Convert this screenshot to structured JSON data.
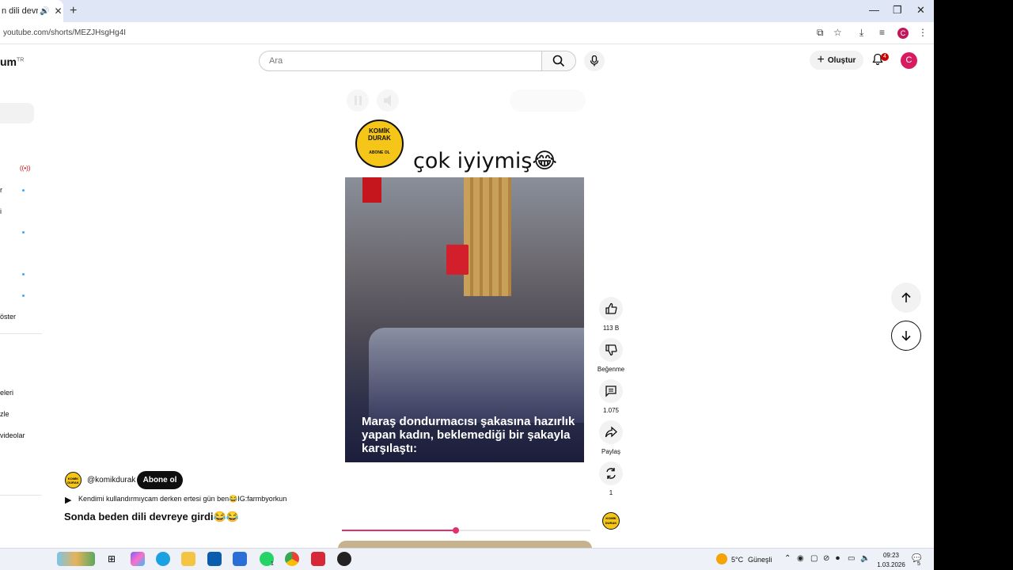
{
  "browser": {
    "tab_title": "n dili devreye",
    "tab_audio_icon": "speaker-icon",
    "url": "youtube.com/shorts/MEZJHsgHg4I",
    "profile_initial": "C"
  },
  "header": {
    "logo_text": "um",
    "logo_region": "TR",
    "search_placeholder": "Ara",
    "create_label": "Oluştur",
    "notification_count": "4",
    "avatar_initial": "C"
  },
  "sidebar": {
    "fragments": [
      "r",
      "i",
      "öster",
      "eleri",
      "zle",
      "videolar"
    ]
  },
  "video": {
    "badge_line1": "KOMİK",
    "badge_line2": "DURAK",
    "badge_sub": "ABONE OL",
    "caption": "çok iyiymiş😂",
    "overlay_text": "Maraş dondurmacısı şakasına hazırlık yapan kadın, beklemediği bir şakayla karşılaştı:",
    "progress": 0.46
  },
  "actions": {
    "like_count": "113 B",
    "dislike_label": "Beğenme",
    "comment_count": "1.075",
    "share_label": "Paylaş",
    "remix_count": "1"
  },
  "meta": {
    "channel_handle": "@komikdurak",
    "subscribe_label": "Abone ol",
    "sound_text": "Kendimi kullandırmıycam derken ertesi gün ben😂IG:farmbyorkun",
    "title": "Sonda beden dili devreye girdi😂😂"
  },
  "taskbar": {
    "weather_temp": "5°C",
    "weather_desc": "Güneşli",
    "time": "09:23",
    "date": "1.03.2026",
    "whatsapp_badge": "1",
    "notification_badge": "5"
  },
  "colors": {
    "accent": "#e1306c",
    "subscribe_bg": "#0f0f0f",
    "avatar": "#d81b60"
  }
}
